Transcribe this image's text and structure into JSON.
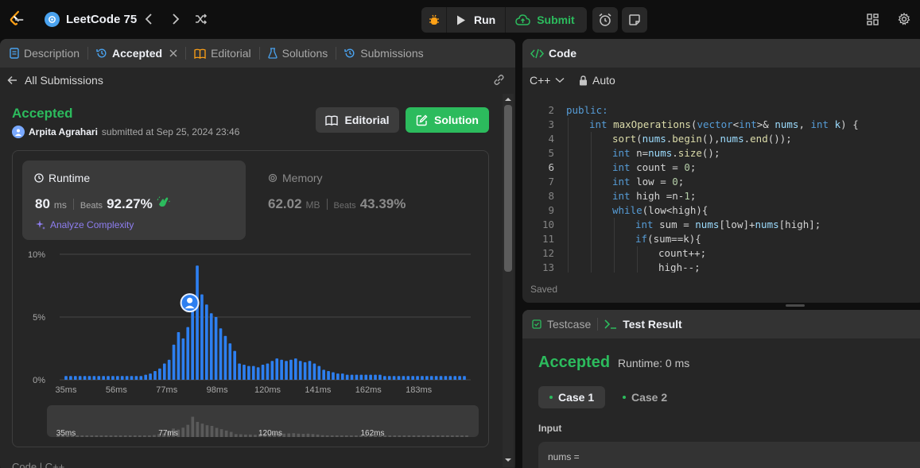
{
  "topbar": {
    "list_title": "LeetCode 75",
    "run_label": "Run",
    "submit_label": "Submit"
  },
  "left_tabs": [
    {
      "label": "Description"
    },
    {
      "label": "Accepted"
    },
    {
      "label": "Editorial"
    },
    {
      "label": "Solutions"
    },
    {
      "label": "Submissions"
    }
  ],
  "submission": {
    "back_label": "All Submissions",
    "status": "Accepted",
    "author": "Arpita Agrahari",
    "submitted_text": "submitted at Sep 25, 2024 23:46",
    "editorial_btn": "Editorial",
    "solution_btn": "Solution",
    "runtime_label": "Runtime",
    "runtime_value": "80",
    "runtime_unit": "ms",
    "beats_label": "Beats",
    "runtime_beats": "92.27%",
    "analyze_label": "Analyze Complexity",
    "memory_label": "Memory",
    "memory_value": "62.02",
    "memory_unit": "MB",
    "memory_beats": "43.39%",
    "bottom_partial": "Code  |  C++"
  },
  "chart_data": {
    "type": "bar",
    "y_ticks": [
      "10%",
      "5%",
      "0%"
    ],
    "ylim": [
      0,
      10
    ],
    "x_ticks": [
      "35ms",
      "56ms",
      "77ms",
      "98ms",
      "120ms",
      "141ms",
      "162ms",
      "183ms"
    ],
    "values": [
      0.3,
      0.3,
      0.3,
      0.3,
      0.3,
      0.3,
      0.3,
      0.3,
      0.3,
      0.3,
      0.3,
      0.3,
      0.3,
      0.3,
      0.3,
      0.3,
      0.3,
      0.4,
      0.5,
      0.7,
      0.9,
      1.3,
      1.6,
      2.8,
      3.8,
      3.3,
      4.2,
      5.5,
      9.1,
      6.8,
      6.0,
      5.3,
      5.0,
      4.1,
      3.5,
      2.9,
      2.3,
      1.3,
      1.2,
      1.1,
      1.1,
      1.0,
      1.2,
      1.3,
      1.5,
      1.7,
      1.6,
      1.5,
      1.6,
      1.7,
      1.5,
      1.4,
      1.5,
      1.3,
      1.1,
      0.8,
      0.7,
      0.6,
      0.5,
      0.5,
      0.4,
      0.4,
      0.4,
      0.4,
      0.4,
      0.4,
      0.4,
      0.4,
      0.3,
      0.3,
      0.3,
      0.3,
      0.3,
      0.3,
      0.3,
      0.3,
      0.3,
      0.3,
      0.3,
      0.3,
      0.3,
      0.3,
      0.3,
      0.3,
      0.3,
      0.3
    ],
    "highlight_index": 27,
    "mini_x_ticks": [
      "35ms",
      "77ms",
      "120ms",
      "162ms"
    ]
  },
  "code_panel": {
    "title": "Code",
    "language": "C++",
    "mode": "Auto",
    "saved_label": "Saved",
    "lines": [
      {
        "n": "2",
        "indent": 0,
        "tokens": [
          [
            "public:",
            "kw"
          ]
        ]
      },
      {
        "n": "3",
        "indent": 1,
        "tokens": [
          [
            "int",
            "ty"
          ],
          [
            " ",
            "pl"
          ],
          [
            "maxOperations",
            "fn"
          ],
          [
            "(",
            "pl"
          ],
          [
            "vector",
            "ty"
          ],
          [
            "<",
            "pl"
          ],
          [
            "int",
            "ty"
          ],
          [
            ">& ",
            "pl"
          ],
          [
            "nums",
            "va"
          ],
          [
            ", ",
            "pl"
          ],
          [
            "int",
            "ty"
          ],
          [
            " ",
            "pl"
          ],
          [
            "k",
            "va"
          ],
          [
            ") {",
            "pl"
          ]
        ]
      },
      {
        "n": "4",
        "indent": 2,
        "tokens": [
          [
            "sort",
            "fn"
          ],
          [
            "(",
            "pl"
          ],
          [
            "nums",
            "va"
          ],
          [
            ".",
            "pl"
          ],
          [
            "begin",
            "fn"
          ],
          [
            "(),",
            "pl"
          ],
          [
            "nums",
            "va"
          ],
          [
            ".",
            "pl"
          ],
          [
            "end",
            "fn"
          ],
          [
            "());",
            "pl"
          ]
        ]
      },
      {
        "n": "5",
        "indent": 2,
        "tokens": [
          [
            "int",
            "ty"
          ],
          [
            " n=",
            "pl"
          ],
          [
            "nums",
            "va"
          ],
          [
            ".",
            "pl"
          ],
          [
            "size",
            "fn"
          ],
          [
            "();",
            "pl"
          ]
        ]
      },
      {
        "n": "6",
        "indent": 2,
        "tokens": [
          [
            "int",
            "ty"
          ],
          [
            " count = ",
            "pl"
          ],
          [
            "0",
            "nu"
          ],
          [
            ";",
            "pl"
          ]
        ]
      },
      {
        "n": "7",
        "indent": 2,
        "tokens": [
          [
            "int",
            "ty"
          ],
          [
            " low = ",
            "pl"
          ],
          [
            "0",
            "nu"
          ],
          [
            ";",
            "pl"
          ]
        ]
      },
      {
        "n": "8",
        "indent": 2,
        "tokens": [
          [
            "int",
            "ty"
          ],
          [
            " high =n-",
            "pl"
          ],
          [
            "1",
            "nu"
          ],
          [
            ";",
            "pl"
          ]
        ]
      },
      {
        "n": "9",
        "indent": 2,
        "tokens": [
          [
            "while",
            "kw"
          ],
          [
            "(low<high){",
            "pl"
          ]
        ]
      },
      {
        "n": "10",
        "indent": 3,
        "tokens": [
          [
            "int",
            "ty"
          ],
          [
            " sum = ",
            "pl"
          ],
          [
            "nums",
            "va"
          ],
          [
            "[low]+",
            "pl"
          ],
          [
            "nums",
            "va"
          ],
          [
            "[high];",
            "pl"
          ]
        ]
      },
      {
        "n": "11",
        "indent": 3,
        "tokens": [
          [
            "if",
            "kw"
          ],
          [
            "(sum==k){",
            "pl"
          ]
        ]
      },
      {
        "n": "12",
        "indent": 4,
        "tokens": [
          [
            "count++;",
            "pl"
          ]
        ]
      },
      {
        "n": "13",
        "indent": 4,
        "tokens": [
          [
            "high--;",
            "pl"
          ]
        ]
      }
    ]
  },
  "test_panel": {
    "tab_testcase": "Testcase",
    "tab_result": "Test Result",
    "status": "Accepted",
    "runtime_text": "Runtime: 0 ms",
    "case1": "Case 1",
    "case2": "Case 2",
    "input_label": "Input",
    "input_var": "nums ="
  },
  "colors": {
    "accent_green": "#2cbb5d",
    "bar_blue": "#2d7ff0",
    "panel_bg": "#262626",
    "header_bg": "#333333"
  }
}
